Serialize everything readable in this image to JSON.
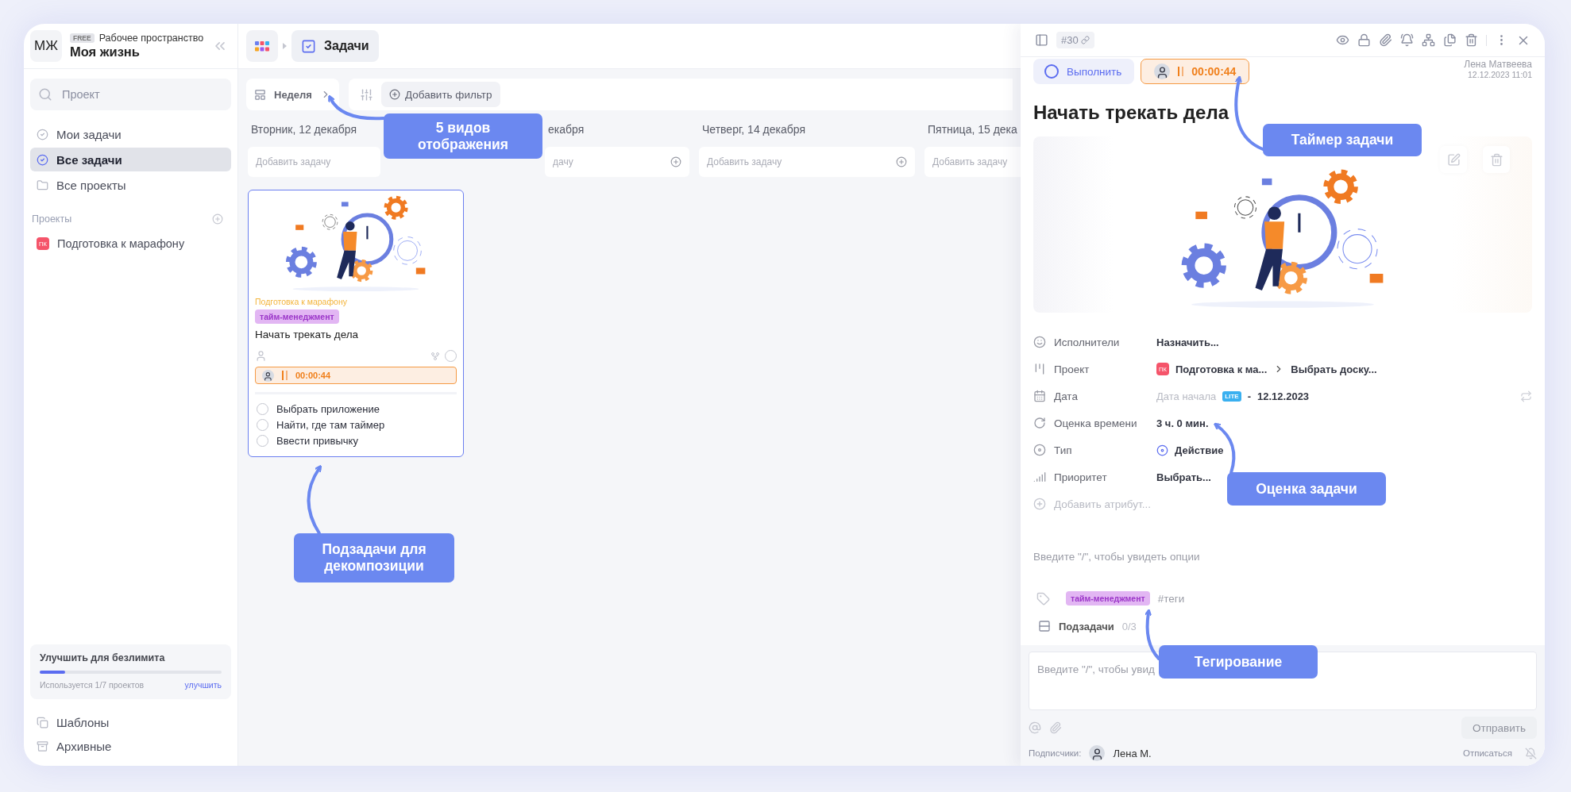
{
  "sidebar": {
    "avatar": "МЖ",
    "plan_badge": "FREE",
    "workspace_label": "Рабочее пространство",
    "workspace_name": "Моя жизнь",
    "search": {
      "placeholder": "Проект"
    },
    "nav": [
      {
        "kind": "my_tasks",
        "label": "Мои задачи",
        "selected": false
      },
      {
        "kind": "all_tasks",
        "label": "Все задачи",
        "selected": true
      },
      {
        "kind": "projects",
        "label": "Все проекты",
        "selected": false
      }
    ],
    "projects_heading": "Проекты",
    "projects": [
      {
        "initials": "ПК",
        "name": "Подготовка к марафону",
        "color": "#f5546a"
      }
    ],
    "upgrade": {
      "title": "Улучшить для безлимита",
      "level": 0.14,
      "usage": "Используется 1/7 проектов",
      "link": "улучшить"
    },
    "footer_items": [
      {
        "kind": "templates",
        "label": "Шаблоны"
      },
      {
        "kind": "archive",
        "label": "Архивные"
      }
    ]
  },
  "breadcrumb": {
    "current": "Задачи"
  },
  "toolbar": {
    "view": "Неделя",
    "add_filter": "Добавить фильтр"
  },
  "columns": [
    {
      "header": "Вторник, 12 декабря",
      "add_placeholder": "Добавить задачу",
      "add_icon": false,
      "cards": [
        {
          "project": "Подготовка к марафону",
          "tag": "тайм-менеджмент",
          "title": "Начать трекать дела",
          "timer": "00:00:44",
          "subtasks": [
            {
              "label": "Выбрать приложение",
              "checked": false
            },
            {
              "label": "Найти, где там таймер",
              "checked": false
            },
            {
              "label": "Ввести привычку",
              "checked": false
            }
          ]
        }
      ]
    },
    {
      "header": "екабря",
      "add_placeholder": "дачу",
      "add_icon": true
    },
    {
      "header": "Четверг, 14 декабря",
      "add_placeholder": "Добавить задачу",
      "add_icon": true
    },
    {
      "header": "Пятница, 15 дека",
      "add_placeholder": "Добавить задачу"
    }
  ],
  "task_panel": {
    "number": "#30",
    "complete_button": "Выполнить",
    "timer": "00:00:44",
    "author": "Лена Матвеева",
    "created": "12.12.2023 11:01",
    "title": "Начать трекать дела",
    "attributes": [
      {
        "kind": "assignees",
        "label": "Исполнители",
        "value": "Назначить..."
      },
      {
        "kind": "project",
        "label": "Проект",
        "project_initials": "ПК",
        "value": "Подготовка к ма...",
        "board": "Выбрать доску..."
      },
      {
        "kind": "date",
        "label": "Дата",
        "start": "Дата начала",
        "start_badge": "LITE",
        "separator": "-",
        "value": "12.12.2023"
      },
      {
        "kind": "estimate",
        "label": "Оценка времени",
        "value": "3 ч. 0 мин."
      },
      {
        "kind": "type",
        "label": "Тип",
        "value": "Действие"
      },
      {
        "kind": "priority",
        "label": "Приоритет",
        "value": "Выбрать..."
      }
    ],
    "add_attribute": "Добавить атрибут...",
    "editor_placeholder": "Введите \"/\", чтобы увидеть опции",
    "tags": [
      "тайм-менеджмент"
    ],
    "tag_placeholder": "#теги",
    "subtasks_label": "Подзадачи",
    "subtasks_count": "0/3",
    "comment": {
      "placeholder": "Введите \"/\", чтобы увид",
      "send": "Отправить"
    },
    "subscribers_label": "Подписчики:",
    "subscriber": "Лена М.",
    "unsubscribe": "Отписаться"
  },
  "callouts": [
    {
      "text": "5 видов отображения"
    },
    {
      "text": "Подзадачи для декомпозиции"
    },
    {
      "text": "Таймер задачи"
    },
    {
      "text": "Оценка задачи"
    },
    {
      "text": "Тегирование"
    }
  ]
}
